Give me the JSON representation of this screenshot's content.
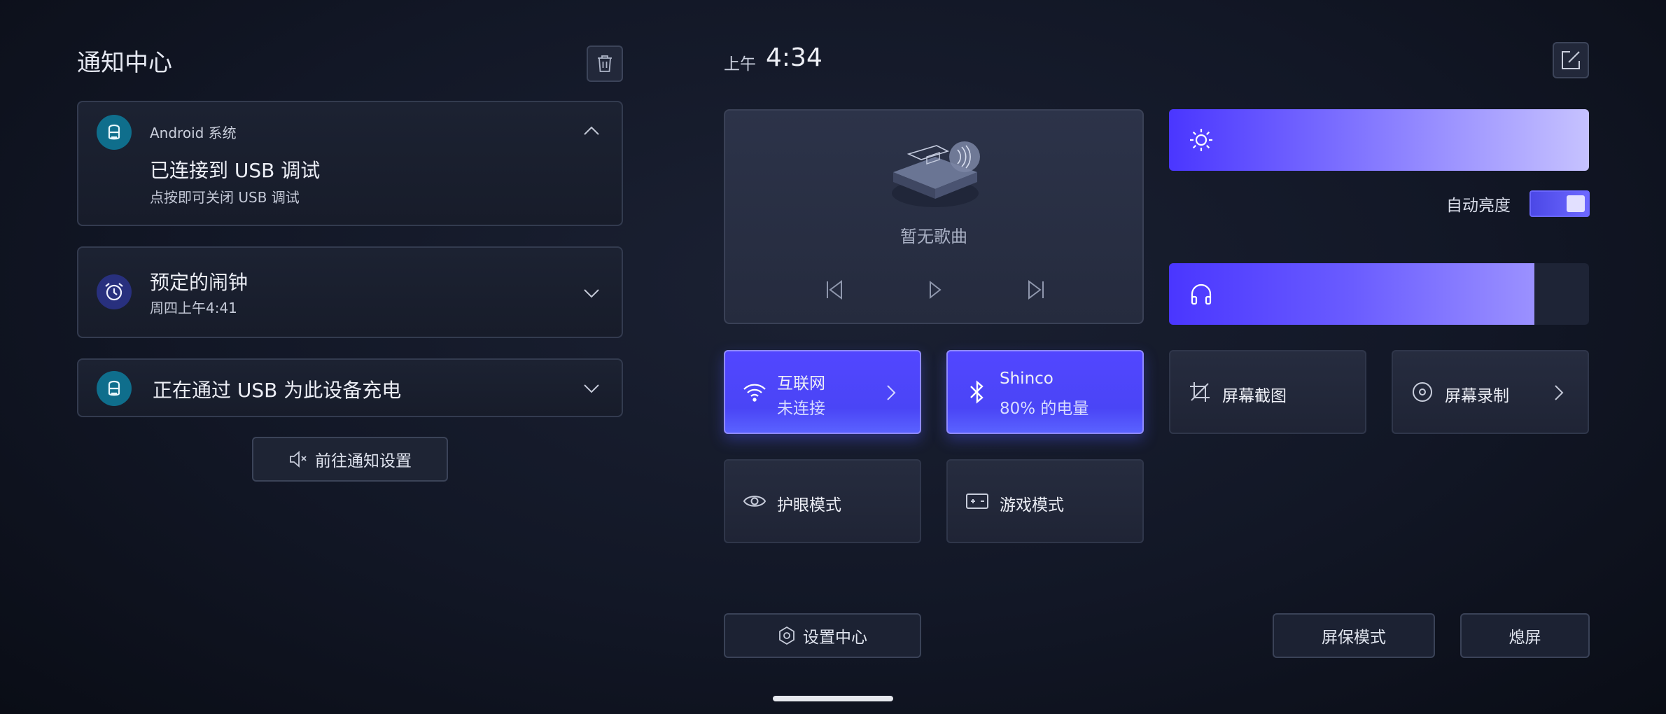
{
  "notification_center": {
    "title": "通知中心",
    "cards": [
      {
        "app": "Android 系统",
        "title": "已连接到 USB 调试",
        "subtitle": "点按即可关闭 USB 调试"
      },
      {
        "title": "预定的闹钟",
        "subtitle": "周四上午4:41"
      },
      {
        "title": "正在通过 USB 为此设备充电"
      }
    ],
    "settings_button": "前往通知设置"
  },
  "header": {
    "ampm": "上午",
    "time": "4:34"
  },
  "music": {
    "title": "暂无歌曲"
  },
  "brightness": {
    "level_percent": 100,
    "auto_label": "自动亮度",
    "auto_on": true
  },
  "volume": {
    "level_percent": 87
  },
  "tiles": {
    "internet": {
      "label": "互联网",
      "status": "未连接"
    },
    "bluetooth": {
      "label": "Shinco",
      "status": "80% 的电量"
    },
    "screenshot": {
      "label": "屏幕截图"
    },
    "screen_record": {
      "label": "屏幕录制"
    },
    "eye_care": {
      "label": "护眼模式"
    },
    "game_mode": {
      "label": "游戏模式"
    }
  },
  "bottom": {
    "settings_center": "设置中心",
    "screensaver": "屏保模式",
    "screen_off": "熄屏"
  },
  "colors": {
    "accent": "#4f46ff",
    "background": "#121726",
    "card": "#1c2232",
    "android_icon_bg": "#0f6e8c",
    "alarm_icon_bg": "#28307e"
  },
  "icons": {
    "trash": "trash-icon",
    "edit": "edit-icon",
    "android": "android-icon",
    "alarm": "alarm-clock-icon",
    "sun": "sun-icon",
    "headphones": "headphones-icon",
    "wifi": "wifi-icon",
    "bluetooth": "bluetooth-icon",
    "crop": "crop-icon",
    "record": "record-icon",
    "eye": "eye-icon",
    "gamepad": "gamepad-icon",
    "settings": "settings-hexagon-icon",
    "notification_settings": "mute-speaker-icon"
  }
}
